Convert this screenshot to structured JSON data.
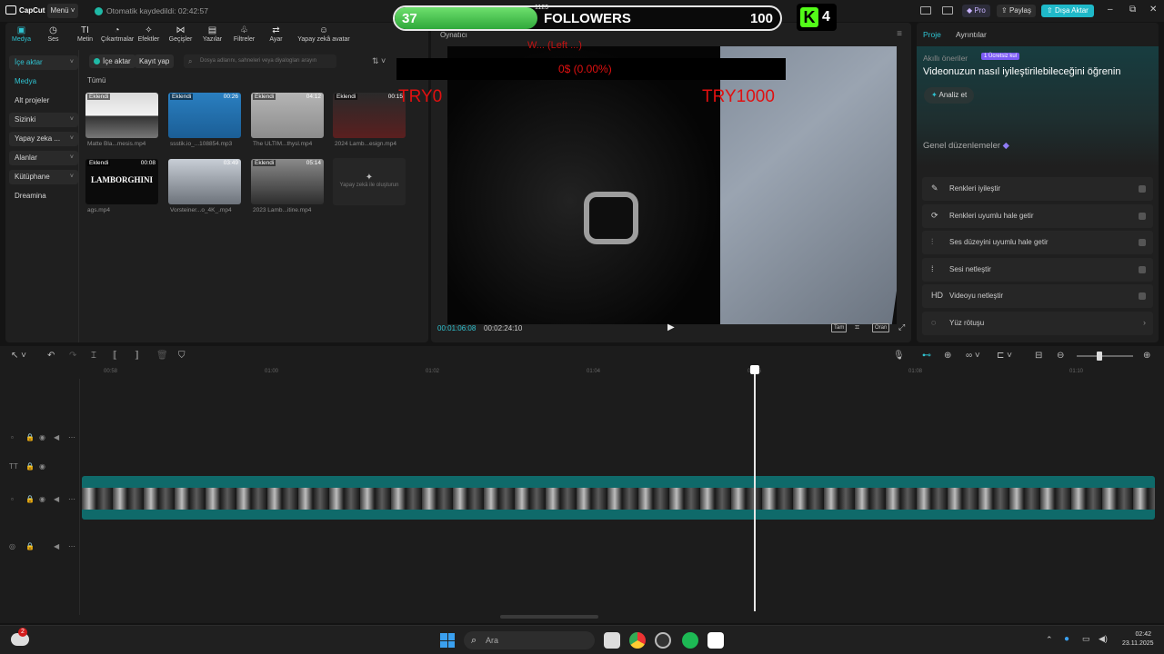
{
  "app": {
    "logo_text": "CapCut",
    "menu_label": "Menü",
    "autosave_text": "Otomatik kaydedildi: 02:42:57"
  },
  "overlay": {
    "followers_start": "37",
    "followers_title": "FOLLOWERS",
    "followers_end": "100",
    "followers_current": "1123",
    "followers_progress": 0.37,
    "kick_count": "4",
    "video_top_text": "W... (Left ...)",
    "video_pct_text": "0$ (0.00%)",
    "try_left": "TRY0",
    "try_right": "TRY1000"
  },
  "header_right": {
    "pro_label": "Pro",
    "share_label": "Paylaş",
    "export_label": "Dışa Aktar",
    "minimize": "–",
    "maximize": "⧉",
    "close": "✕"
  },
  "toolbar": {
    "items": [
      {
        "icon": "media-icon",
        "glyph": "▣",
        "label": "Medya"
      },
      {
        "icon": "audio-icon",
        "glyph": "◷",
        "label": "Ses"
      },
      {
        "icon": "text-icon",
        "glyph": "TI",
        "label": "Metin"
      },
      {
        "icon": "sticker-icon",
        "glyph": "◔",
        "label": "Çıkartmalar"
      },
      {
        "icon": "effects-icon",
        "glyph": "✧",
        "label": "Efektler"
      },
      {
        "icon": "transitions-icon",
        "glyph": "⋈",
        "label": "Geçişler"
      },
      {
        "icon": "captions-icon",
        "glyph": "▤",
        "label": "Yazılar"
      },
      {
        "icon": "filters-icon",
        "glyph": "♧",
        "label": "Filtreler"
      },
      {
        "icon": "adjust-icon",
        "glyph": "⇄",
        "label": "Ayar"
      },
      {
        "icon": "ai-avatar-icon",
        "glyph": "☺",
        "label": "Yapay zekâ avatar"
      }
    ]
  },
  "sidenav": {
    "items": [
      {
        "label": "İçe aktar",
        "type": "group",
        "active": true
      },
      {
        "label": "Medya",
        "type": "item",
        "active": true
      },
      {
        "label": "Alt projeler",
        "type": "item"
      },
      {
        "label": "Sizinki",
        "type": "group"
      },
      {
        "label": "Yapay zeka ...",
        "type": "group"
      },
      {
        "label": "Alanlar",
        "type": "group"
      },
      {
        "label": "Kütüphane",
        "type": "group"
      },
      {
        "label": "Dreamina",
        "type": "item"
      }
    ]
  },
  "media": {
    "import_label": "İçe aktar",
    "record_label": "Kayıt yap",
    "search_placeholder": "Dosya adlarını, sahneleri veya diyalogları arayın",
    "filter_label": "Tümü",
    "ai_generate_label": "Yapay zekâ ile oluşturun",
    "clips": [
      {
        "tag": "Eklendi",
        "duration": "",
        "name": "Matte Bla...mesis.mp4"
      },
      {
        "tag": "Eklendi",
        "duration": "00:26",
        "name": "ssstik.io_...108854.mp3"
      },
      {
        "tag": "Eklendi",
        "duration": "04:12",
        "name": "The ULTIM...thysl.mp4"
      },
      {
        "tag": "Eklendi",
        "duration": "00:15",
        "name": "2024 Lamb...esign.mp4"
      },
      {
        "tag": "Eklendi",
        "duration": "00:08",
        "name": "ags.mp4",
        "overlay_text": "LAMBORGHINI"
      },
      {
        "tag": "",
        "duration": "03:49",
        "name": "Vorsteiner...o_4K_.mp4"
      },
      {
        "tag": "Eklendi",
        "duration": "05:14",
        "name": "2023 Lamb...itine.mp4"
      }
    ]
  },
  "player": {
    "title": "Oynatıcı",
    "time_current": "00:01:06:08",
    "time_total": "00:02:24:10",
    "full_label": "Tam",
    "ratio_label": "Oran"
  },
  "right_panel": {
    "tab_project": "Proje",
    "tab_details": "Ayrıntılar",
    "ai_label": "Akıllı öneriler",
    "ai_badge": "1 Ücretsiz kul",
    "ai_heading": "Videonuzun nasıl iyileştirilebileceğini öğrenin",
    "analyze_label": "Analiz et",
    "general_title": "Genel düzenlemeler",
    "edits": [
      {
        "icon": "wand-icon",
        "glyph": "✎",
        "label": "Renkleri iyileştir",
        "kind": "toggle"
      },
      {
        "icon": "color-match-icon",
        "glyph": "⟳",
        "label": "Renkleri uyumlu hale getir",
        "kind": "toggle"
      },
      {
        "icon": "audio-level-icon",
        "glyph": "⫶",
        "label": "Ses düzeyini uyumlu hale getir",
        "kind": "toggle"
      },
      {
        "icon": "audio-clean-icon",
        "glyph": "⁞",
        "label": "Sesi netleştir",
        "kind": "toggle"
      },
      {
        "icon": "hd-icon",
        "glyph": "HD",
        "label": "Videoyu netleştir",
        "kind": "toggle"
      },
      {
        "icon": "face-retouch-icon",
        "glyph": "◌",
        "label": "Yüz rötuşu",
        "kind": "arrow"
      }
    ]
  },
  "timeline": {
    "ticks": [
      "00:58",
      "01:00",
      "01:02",
      "01:04",
      "01:06",
      "01:08",
      "01:10"
    ]
  },
  "taskbar": {
    "weather_badge": "2",
    "search_label": "Ara",
    "time": "02:42",
    "date": "23.11.2025"
  }
}
